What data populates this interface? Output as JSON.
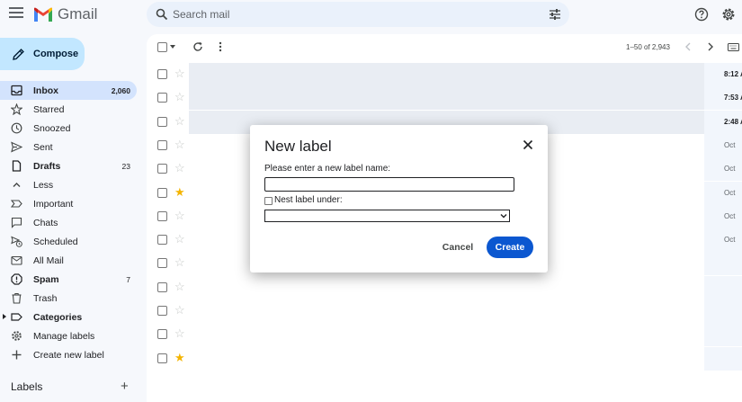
{
  "app": {
    "brand": "Gmail"
  },
  "search": {
    "placeholder": "Search mail"
  },
  "compose": {
    "label": "Compose"
  },
  "sidebar": {
    "items": [
      {
        "label": "Inbox",
        "count": "2,060",
        "icon": "inbox-icon",
        "active": true
      },
      {
        "label": "Starred",
        "count": "",
        "icon": "star-outline-icon"
      },
      {
        "label": "Snoozed",
        "count": "",
        "icon": "clock-icon"
      },
      {
        "label": "Sent",
        "count": "",
        "icon": "send-icon"
      },
      {
        "label": "Drafts",
        "count": "23",
        "icon": "draft-icon",
        "bold": true
      },
      {
        "label": "Less",
        "count": "",
        "icon": "chevron-up-icon"
      },
      {
        "label": "Important",
        "count": "",
        "icon": "important-icon"
      },
      {
        "label": "Chats",
        "count": "",
        "icon": "chat-icon"
      },
      {
        "label": "Scheduled",
        "count": "",
        "icon": "scheduled-send-icon"
      },
      {
        "label": "All Mail",
        "count": "",
        "icon": "all-mail-icon"
      },
      {
        "label": "Spam",
        "count": "7",
        "icon": "spam-icon",
        "bold": true
      },
      {
        "label": "Trash",
        "count": "",
        "icon": "trash-icon"
      },
      {
        "label": "Categories",
        "count": "",
        "icon": "label-icon",
        "bold": true
      },
      {
        "label": "Manage labels",
        "count": "",
        "icon": "gear-icon"
      },
      {
        "label": "Create new label",
        "count": "",
        "icon": "plus-icon"
      }
    ],
    "labels_header": "Labels"
  },
  "list": {
    "pager": "1–50 of 2,943",
    "rows": [
      {
        "time": "8:12 A",
        "unread": true,
        "starred": false
      },
      {
        "time": "7:53 A",
        "unread": true,
        "starred": false
      },
      {
        "time": "2:48 A",
        "unread": true,
        "starred": false
      },
      {
        "time": "Oct",
        "unread": false,
        "starred": false
      },
      {
        "time": "Oct",
        "unread": false,
        "starred": false
      },
      {
        "time": "Oct",
        "unread": false,
        "starred": true
      },
      {
        "time": "Oct",
        "unread": false,
        "starred": false
      },
      {
        "time": "Oct",
        "unread": false,
        "starred": false
      },
      {
        "time": "",
        "unread": false,
        "starred": false
      },
      {
        "time": "",
        "unread": false,
        "starred": false
      },
      {
        "time": "",
        "unread": false,
        "starred": false
      },
      {
        "time": "",
        "unread": false,
        "starred": false
      },
      {
        "time": "",
        "unread": false,
        "starred": true
      }
    ]
  },
  "dialog": {
    "title": "New label",
    "prompt": "Please enter a new label name:",
    "input_value": "",
    "nest_label": "Nest label under:",
    "nest_checked": false,
    "nest_selected": "",
    "cancel_label": "Cancel",
    "create_label": "Create"
  },
  "colors": {
    "accent": "#0b57d0",
    "compose_bg": "#c2e7ff",
    "active_nav": "#d3e3fd",
    "star": "#f4b400"
  }
}
